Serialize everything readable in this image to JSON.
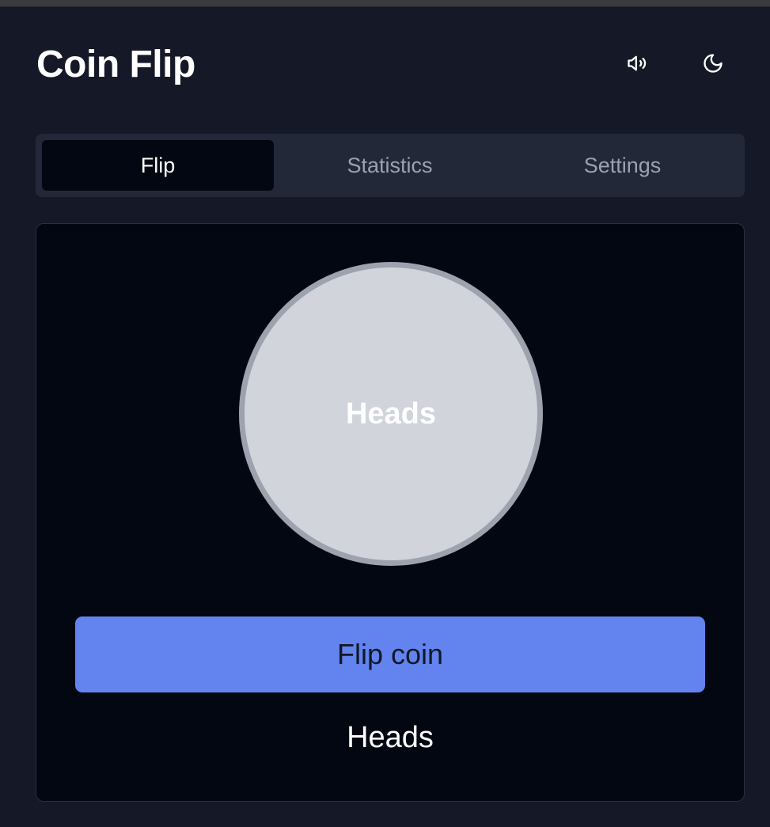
{
  "app": {
    "title": "Coin Flip"
  },
  "header": {
    "sound_icon": "volume-icon",
    "theme_icon": "moon-icon"
  },
  "tabs": [
    {
      "label": "Flip",
      "active": true
    },
    {
      "label": "Statistics",
      "active": false
    },
    {
      "label": "Settings",
      "active": false
    }
  ],
  "coin": {
    "face_label": "Heads"
  },
  "flip_button": {
    "label": "Flip coin"
  },
  "result": {
    "text": "Heads"
  },
  "colors": {
    "background": "#151927",
    "card": "#030712",
    "accent": "#6383ee",
    "coin_face": "#d1d5db",
    "coin_rim": "#9ca3af"
  }
}
